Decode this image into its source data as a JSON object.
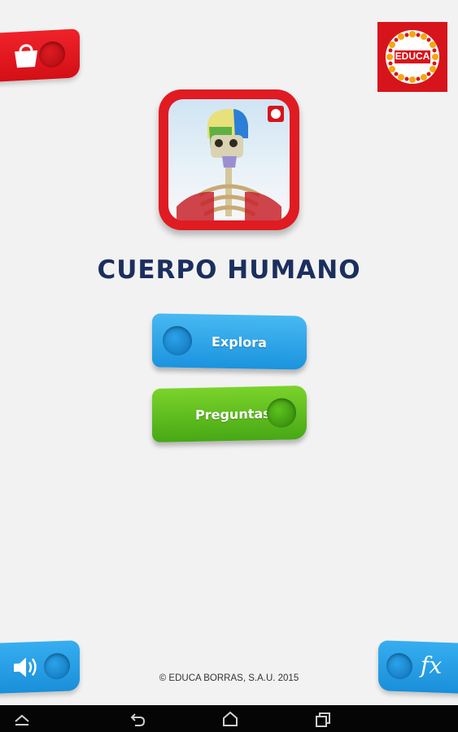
{
  "app": {
    "title": "CUERPO HUMANO",
    "copyright": "© EDUCA BORRAS, S.A.U. 2015",
    "brand_text": "EDUCA"
  },
  "menu": {
    "explore_label": "Explora",
    "questions_label": "Preguntas"
  },
  "corner_buttons": {
    "shop_icon": "shopping-bag-icon",
    "sound_icon": "speaker-icon",
    "fx_label": "fx"
  },
  "navbar": {
    "icons": [
      "home-chevron-icon",
      "back-icon",
      "home-icon",
      "recent-apps-icon"
    ]
  },
  "colors": {
    "brand_red": "#d7141b",
    "explore_blue": "#1b93de",
    "questions_green": "#47a815",
    "title_navy": "#1b2f5e"
  }
}
